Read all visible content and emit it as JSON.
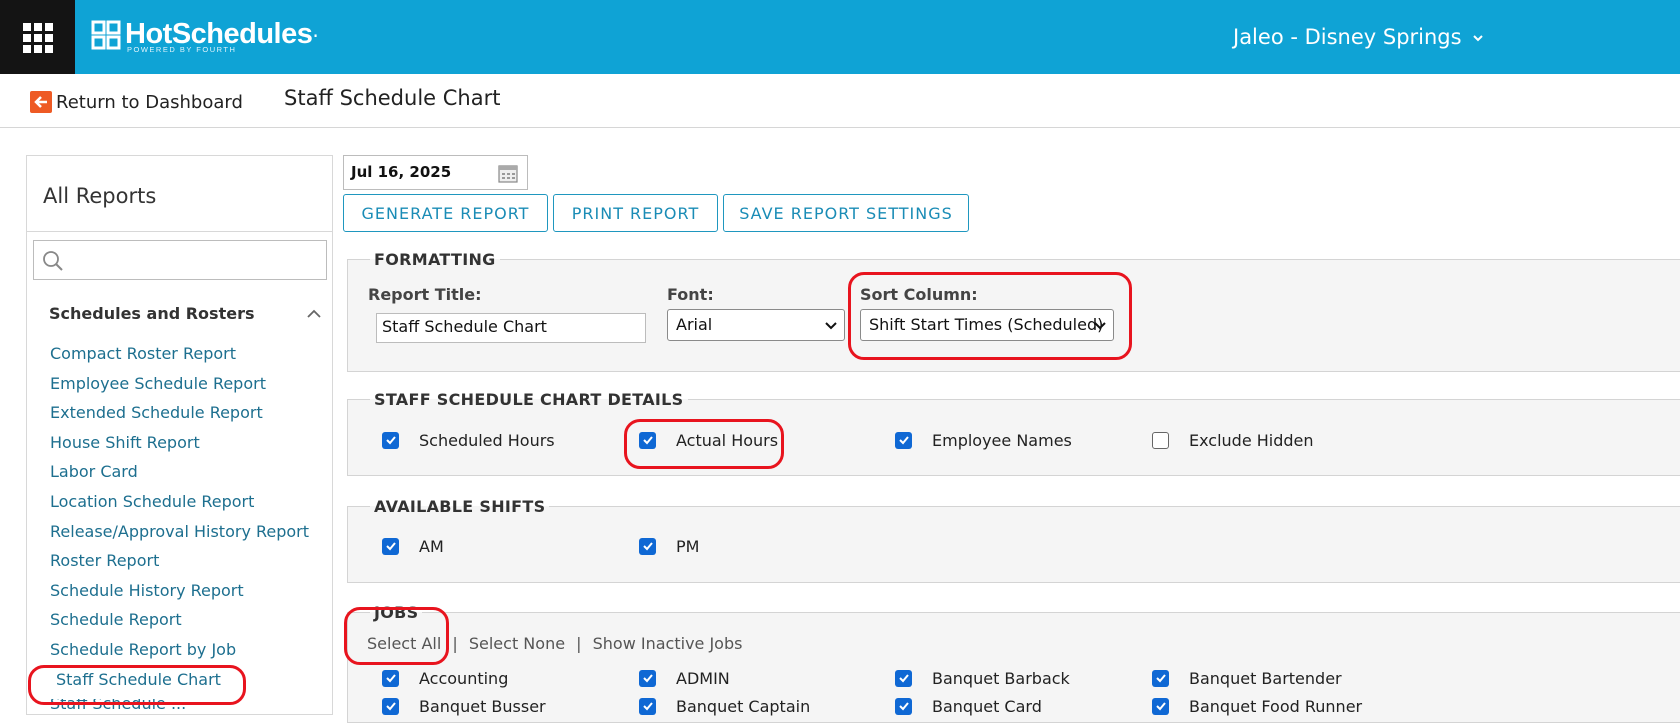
{
  "brand": {
    "logo_text": "HotSchedules",
    "logo_sub": "POWERED BY FOURTH",
    "logo_dot": "."
  },
  "header": {
    "location": "Jaleo - Disney Springs"
  },
  "subheader": {
    "return_label": "Return to Dashboard",
    "page_title": "Staff Schedule Chart"
  },
  "sidebar": {
    "title": "All Reports",
    "search_placeholder": "",
    "section_title": "Schedules and Rosters",
    "items": [
      {
        "label": "Compact Roster Report"
      },
      {
        "label": "Employee Schedule Report"
      },
      {
        "label": "Extended Schedule Report"
      },
      {
        "label": "House Shift Report"
      },
      {
        "label": "Labor Card"
      },
      {
        "label": "Location Schedule Report"
      },
      {
        "label": "Release/Approval History Report"
      },
      {
        "label": "Roster Report"
      },
      {
        "label": "Schedule History Report"
      },
      {
        "label": "Schedule Report"
      },
      {
        "label": "Schedule Report by Job"
      },
      {
        "label": "Staff Schedule Chart"
      },
      {
        "label": "Staff Schedule ..."
      }
    ]
  },
  "toolbar": {
    "date": "Jul 16, 2025",
    "generate": "GENERATE REPORT",
    "print": "PRINT REPORT",
    "save": "SAVE REPORT SETTINGS"
  },
  "formatting": {
    "legend": "FORMATTING",
    "report_title_label": "Report Title:",
    "report_title_value": "Staff Schedule Chart",
    "font_label": "Font:",
    "font_value": "Arial",
    "sort_label": "Sort Column:",
    "sort_value": "Shift Start Times (Scheduled)"
  },
  "details": {
    "legend": "STAFF SCHEDULE CHART DETAILS",
    "options": [
      {
        "label": "Scheduled Hours",
        "checked": true
      },
      {
        "label": "Actual Hours",
        "checked": true
      },
      {
        "label": "Employee Names",
        "checked": true
      },
      {
        "label": "Exclude Hidden",
        "checked": false
      }
    ]
  },
  "shifts": {
    "legend": "AVAILABLE SHIFTS",
    "options": [
      {
        "label": "AM",
        "checked": true
      },
      {
        "label": "PM",
        "checked": true
      }
    ]
  },
  "jobs": {
    "legend": "JOBS",
    "select_all": "Select All",
    "select_none": "Select None",
    "show_inactive": "Show Inactive Jobs",
    "separator": "|",
    "options": [
      {
        "label": "Accounting",
        "checked": true
      },
      {
        "label": "ADMIN",
        "checked": true
      },
      {
        "label": "Banquet Barback",
        "checked": true
      },
      {
        "label": "Banquet Bartender",
        "checked": true
      },
      {
        "label": "Banquet Busser",
        "checked": true
      },
      {
        "label": "Banquet Captain",
        "checked": true
      },
      {
        "label": "Banquet Card",
        "checked": true
      },
      {
        "label": "Banquet Food Runner",
        "checked": true
      }
    ]
  },
  "colors": {
    "topbar": "#0fa3d5",
    "accent": "#1a8cb6",
    "annotation": "#e8141e",
    "checkbox": "#0f68d4"
  }
}
